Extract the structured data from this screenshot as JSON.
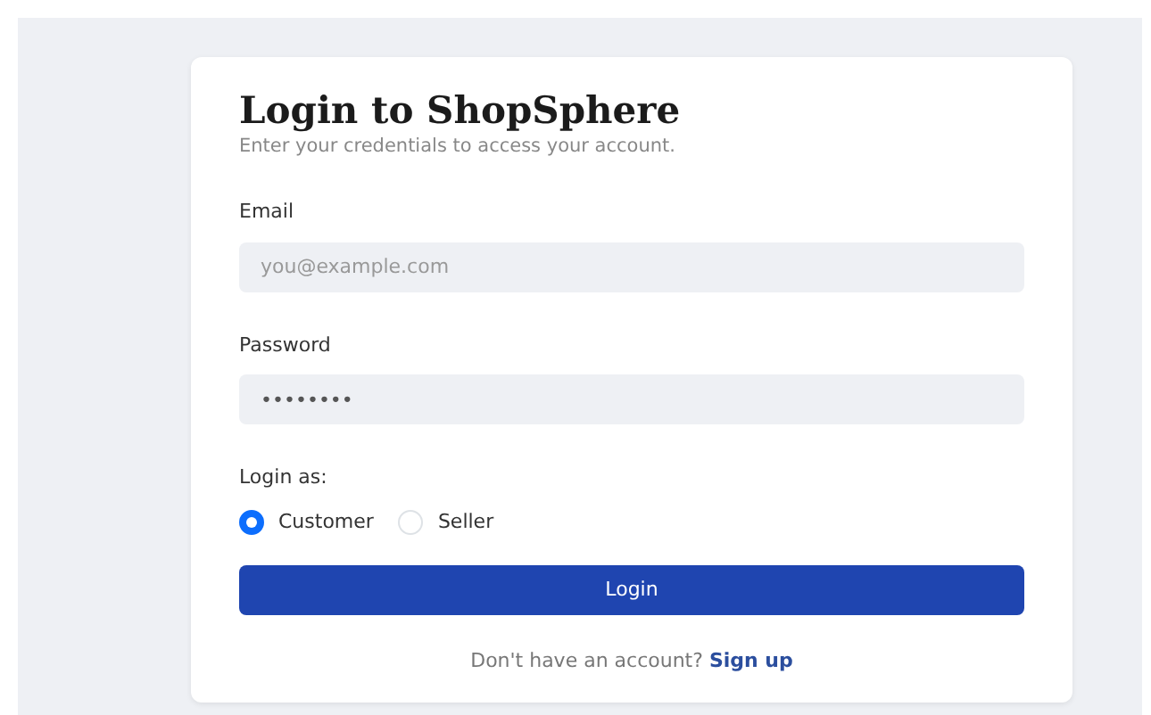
{
  "title": "Login to ShopSphere",
  "subtitle": "Enter your credentials to access your account.",
  "fields": [
    {
      "label": "Email",
      "placeholder": "you@example.com"
    },
    {
      "label": "Password",
      "value": "••••••••"
    }
  ],
  "role_label": "Login as:",
  "roles": [
    {
      "label": "Customer",
      "selected": true
    },
    {
      "label": "Seller",
      "selected": false
    }
  ],
  "submit": "Login",
  "signup": {
    "prompt": "Don't have an account?",
    "link": "Sign up"
  }
}
